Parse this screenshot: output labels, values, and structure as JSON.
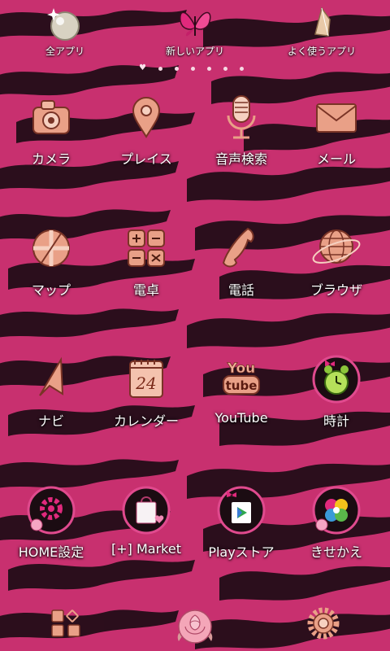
{
  "top_bar": {
    "all_apps": "全アプリ",
    "new_apps": "新しいアプリ",
    "frequent_apps": "よく使うアプリ"
  },
  "apps": {
    "row1": [
      "カメラ",
      "プレイス",
      "音声検索",
      "メール"
    ],
    "row2": [
      "マップ",
      "電卓",
      "電話",
      "ブラウザ"
    ],
    "row3": [
      "ナビ",
      "カレンダー",
      "YouTube",
      "時計"
    ],
    "row4": [
      "HOME設定",
      "[+] Market",
      "Playストア",
      "きせかえ"
    ]
  },
  "calendar_icon_day": "24",
  "youtube_icon_text": {
    "top": "You",
    "bottom": "tube"
  },
  "page_indicator": {
    "pages": 7,
    "current": 1
  },
  "dock": [
    "grid-icon",
    "rose-icon",
    "gear-icon"
  ],
  "colors": {
    "background": "#c8306f",
    "stripe": "#1a0a12",
    "icon_copper": "#e9a087",
    "icon_shadow": "#8a3d2e"
  }
}
